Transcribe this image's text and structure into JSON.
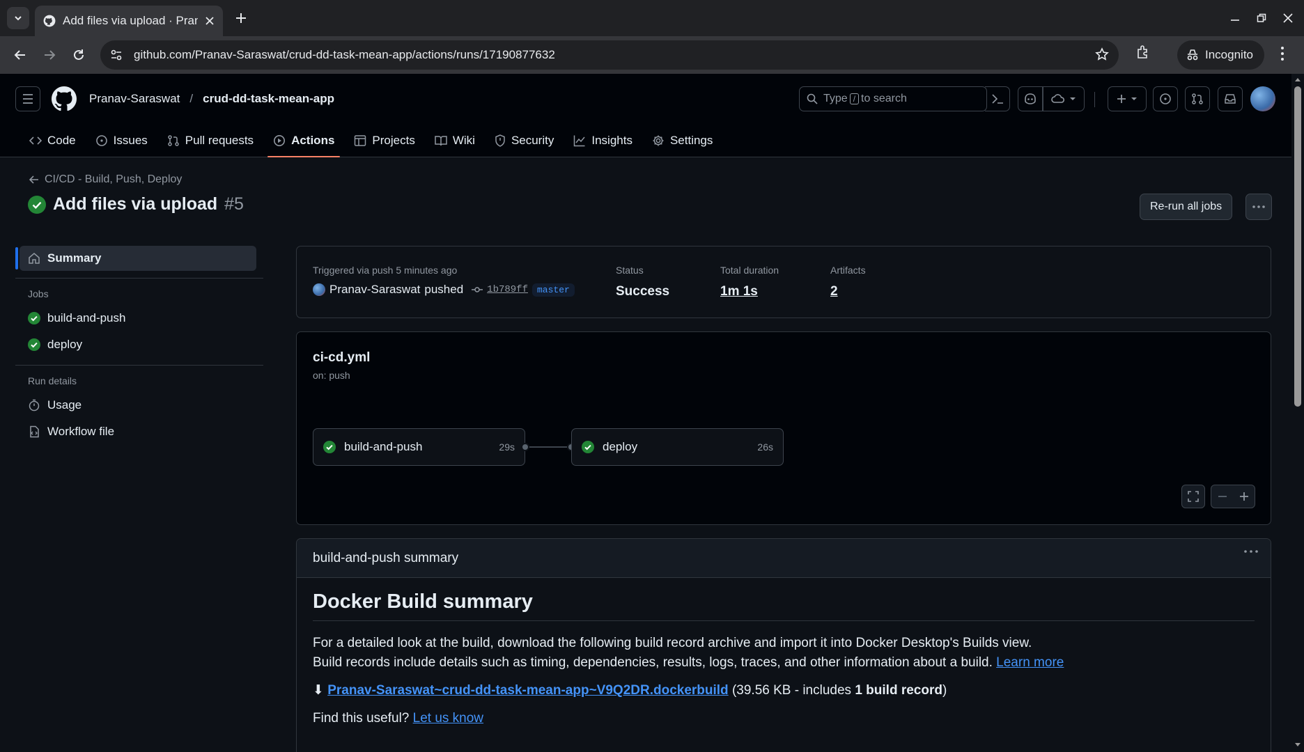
{
  "browser": {
    "tab_title": "Add files via upload · Pran",
    "url": "github.com/Pranav-Saraswat/crud-dd-task-mean-app/actions/runs/17190877632",
    "incognito_label": "Incognito"
  },
  "header": {
    "owner": "Pranav-Saraswat",
    "separator": "/",
    "repo": "crud-dd-task-mean-app",
    "search_prefix": "Type",
    "search_key": "/",
    "search_suffix": "to search"
  },
  "repo_nav": [
    {
      "label": "Code",
      "icon": "code-icon"
    },
    {
      "label": "Issues",
      "icon": "issue-icon"
    },
    {
      "label": "Pull requests",
      "icon": "pull-request-icon"
    },
    {
      "label": "Actions",
      "icon": "play-icon",
      "active": true
    },
    {
      "label": "Projects",
      "icon": "table-icon"
    },
    {
      "label": "Wiki",
      "icon": "book-icon"
    },
    {
      "label": "Security",
      "icon": "shield-icon"
    },
    {
      "label": "Insights",
      "icon": "graph-icon"
    },
    {
      "label": "Settings",
      "icon": "gear-icon"
    }
  ],
  "run": {
    "back_label": "CI/CD - Build, Push, Deploy",
    "title": "Add files via upload",
    "number": "#5",
    "rerun_label": "Re-run all jobs"
  },
  "sidebar": {
    "summary_label": "Summary",
    "jobs_heading": "Jobs",
    "jobs": [
      "build-and-push",
      "deploy"
    ],
    "details_heading": "Run details",
    "details": [
      "Usage",
      "Workflow file"
    ]
  },
  "trigger": {
    "label": "Triggered via push 5 minutes ago",
    "actor": "Pranav-Saraswat",
    "action": "pushed",
    "sha": "1b789ff",
    "branch": "master",
    "status_label": "Status",
    "status_value": "Success",
    "duration_label": "Total duration",
    "duration_value": "1m 1s",
    "artifacts_label": "Artifacts",
    "artifacts_value": "2"
  },
  "graph": {
    "workflow_file": "ci-cd.yml",
    "trigger": "on: push",
    "jobs": [
      {
        "name": "build-and-push",
        "duration": "29s"
      },
      {
        "name": "deploy",
        "duration": "26s"
      }
    ]
  },
  "summary": {
    "header": "build-and-push summary",
    "heading": "Docker Build summary",
    "para1": "For a detailed look at the build, download the following build record archive and import it into Docker Desktop's Builds view.",
    "para2": "Build records include details such as timing, dependencies, results, logs, traces, and other information about a build.",
    "learn_more": "Learn more",
    "download_glyph": "⬇",
    "archive_link": "Pranav-Saraswat~crud-dd-task-mean-app~V9Q2DR.dockerbuild",
    "archive_size": "(39.56 KB - includes",
    "archive_count": "1 build record",
    "archive_close": ")",
    "useful_q": "Find this useful?",
    "let_us_know": "Let us know"
  },
  "colors": {
    "success": "#238636",
    "accent_link": "#4493f8",
    "tab_underline": "#f78166"
  }
}
